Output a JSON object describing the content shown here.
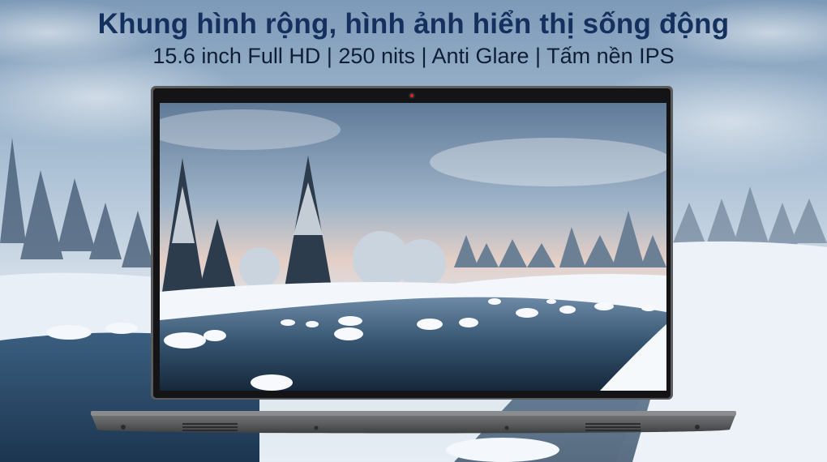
{
  "headline": {
    "title": "Khung hình rộng, hình ảnh hiển thị sống động",
    "subtitle": "15.6 inch Full HD | 250 nits | Anti Glare | Tấm nền IPS"
  },
  "colors": {
    "title": "#14305e",
    "subtitle": "#0f1e35",
    "laptop_body": "#5b5c5e",
    "screen_bezel": "#141416",
    "webcam_light": "#d42a2a"
  },
  "icons": [
    "webcam-icon",
    "speaker-grille-left-icon",
    "speaker-grille-right-icon"
  ]
}
